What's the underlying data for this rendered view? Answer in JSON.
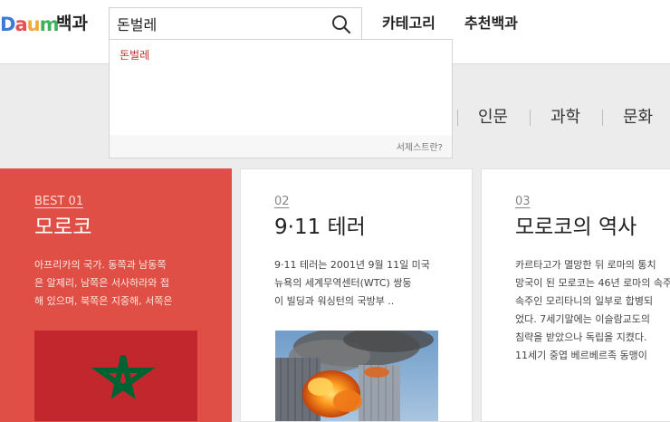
{
  "header": {
    "logo_text": "Daum",
    "service_name": "백과",
    "nav": {
      "category": "카테고리",
      "recommended": "추천백과"
    }
  },
  "search": {
    "query": "돈벌레",
    "suggestions": [
      "돈벌레"
    ],
    "footer_link": "서제스트란?"
  },
  "categories": [
    "인문",
    "과학",
    "문화"
  ],
  "cards": [
    {
      "rank": "BEST 01",
      "title": "모로코",
      "desc": [
        "아프리카의 국가. 동쪽과 남동쪽",
        "은 알제리, 남쪽은 서사하라와 접",
        "해 있으며, 북쪽은 지중해, 서쪽은"
      ],
      "image": "morocco-flag"
    },
    {
      "rank": "02",
      "title": "9·11 테러",
      "desc": [
        "9·11 테러는 2001년 9월 11일 미국",
        "뉴욕의 세계무역센터(WTC) 쌍둥",
        "이 빌딩과 워싱턴의 국방부 .."
      ],
      "image": "wtc-attack-photo"
    },
    {
      "rank": "03",
      "title": "모로코의 역사",
      "desc": [
        "카르타고가 멸망한 뒤 로마의 통치",
        "망국이 된 모로코는 46년 로마의 속주",
        "속주인 모리타니의 일부로 합병되",
        "었다. 7세기말에는 이슬람교도의",
        "침략을 받았으나 독립을 지켰다.",
        "11세기 중엽 베르베르족 동맹이"
      ]
    }
  ],
  "colors": {
    "best_card": "#df4f45",
    "suggest_text": "#c2332b",
    "flag_red": "#c1272d",
    "flag_green": "#006233"
  }
}
